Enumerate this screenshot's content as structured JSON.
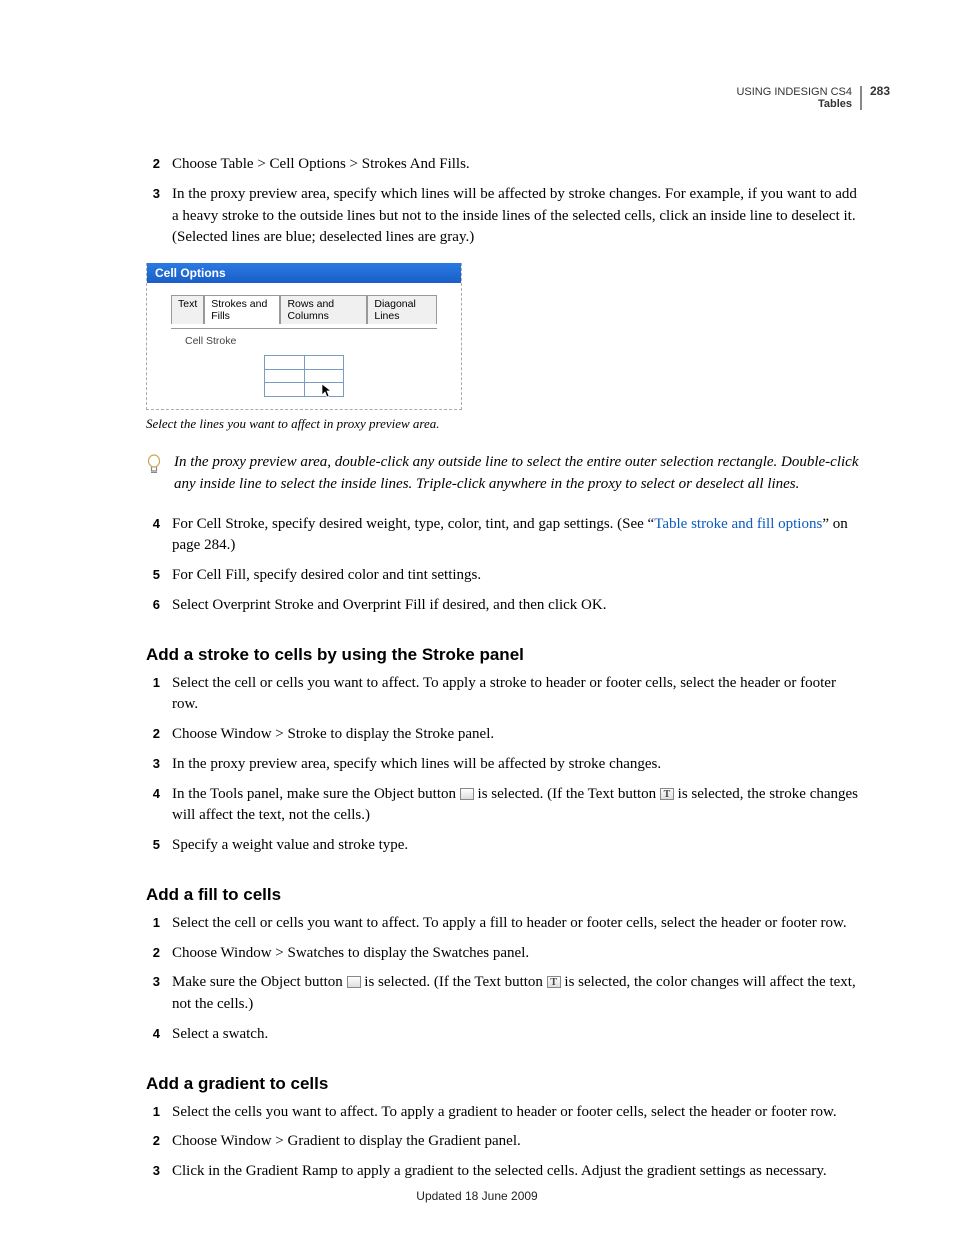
{
  "header": {
    "booktitle": "USING INDESIGN CS4",
    "section": "Tables",
    "pagenum": "283"
  },
  "sectionA": {
    "steps": {
      "2": "Choose Table > Cell Options > Strokes And Fills.",
      "3": "In the proxy preview area, specify which lines will be affected by stroke changes. For example, if you want to add a heavy stroke to the outside lines but not to the inside lines of the selected cells, click an inside line to deselect it. (Selected lines are blue; deselected lines are gray.)"
    },
    "figure": {
      "title": "Cell Options",
      "tabs": [
        "Text",
        "Strokes and Fills",
        "Rows and Columns",
        "Diagonal Lines"
      ],
      "groupbox_label": "Cell Stroke"
    },
    "caption": "Select the lines you want to affect in proxy preview area.",
    "tip": "In the proxy preview area, double-click any outside line to select the entire outer selection rectangle. Double-click any inside line to select the inside lines. Triple-click anywhere in the proxy to select or deselect all lines.",
    "steps2": {
      "4_pre": "For Cell Stroke, specify desired weight, type, color, tint, and gap settings. (See “",
      "4_link": "Table stroke and fill options",
      "4_post": "” on page 284.)",
      "5": "For Cell Fill, specify desired color and tint settings.",
      "6": "Select Overprint Stroke and Overprint Fill if desired, and then click OK."
    }
  },
  "sectionB": {
    "heading": "Add a stroke to cells by using the Stroke panel",
    "steps": {
      "1": "Select the cell or cells you want to affect. To apply a stroke to header or footer cells, select the header or footer row.",
      "2": "Choose Window > Stroke to display the Stroke panel.",
      "3": "In the proxy preview area, specify which lines will be affected by stroke changes.",
      "4_pre": "In the Tools panel, make sure the Object button ",
      "4_mid": " is selected. (If the Text button ",
      "4_post": " is selected, the stroke changes will affect the text, not the cells.)",
      "5": "Specify a weight value and stroke type."
    }
  },
  "sectionC": {
    "heading": "Add a fill to cells",
    "steps": {
      "1": "Select the cell or cells you want to affect. To apply a fill to header or footer cells, select the header or footer row.",
      "2": "Choose Window > Swatches to display the Swatches panel.",
      "3_pre": "Make sure the Object button ",
      "3_mid": " is selected. (If the Text button ",
      "3_post": " is selected, the color changes will affect the text, not the cells.)",
      "4": "Select a swatch."
    }
  },
  "sectionD": {
    "heading": "Add a gradient to cells",
    "steps": {
      "1": "Select the cells you want to affect. To apply a gradient to header or footer cells, select the header or footer row.",
      "2": "Choose Window > Gradient to display the Gradient panel.",
      "3": "Click in the Gradient Ramp to apply a gradient to the selected cells. Adjust the gradient settings as necessary."
    }
  },
  "footer": "Updated 18 June 2009"
}
